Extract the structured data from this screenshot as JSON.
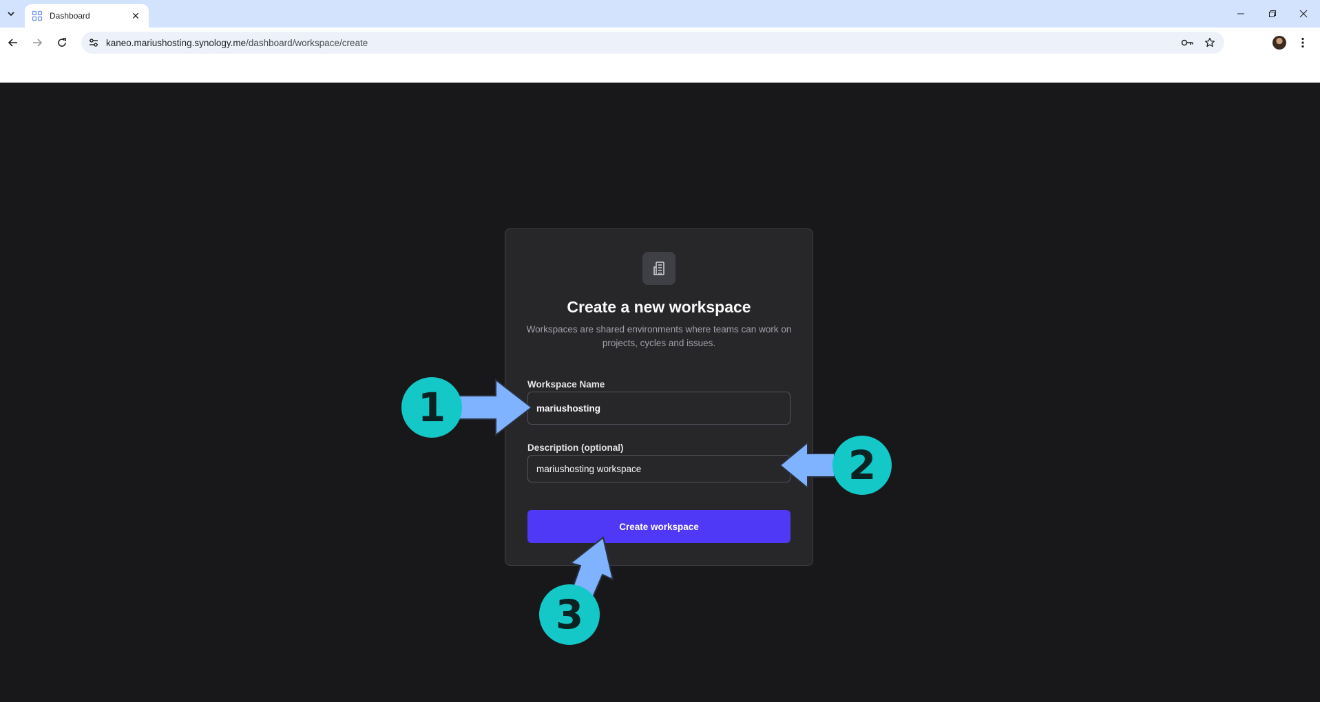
{
  "browser": {
    "tab_title": "Dashboard",
    "url_host": "kaneo.mariushosting.synology.me",
    "url_path": "/dashboard/workspace/create"
  },
  "card": {
    "title": "Create a new workspace",
    "description": "Workspaces are shared environments where teams can work on projects, cycles and issues.",
    "icon": "building-icon"
  },
  "form": {
    "name_label": "Workspace Name",
    "name_value": "mariushosting",
    "description_label": "Description (optional)",
    "description_value": "mariushosting workspace",
    "submit_label": "Create workspace"
  },
  "annotations": {
    "step1": "1",
    "step2": "2",
    "step3": "3"
  },
  "colors": {
    "accent": "#4f39f6",
    "badge": "#14c8c8",
    "arrow": "#7fb2ff"
  }
}
